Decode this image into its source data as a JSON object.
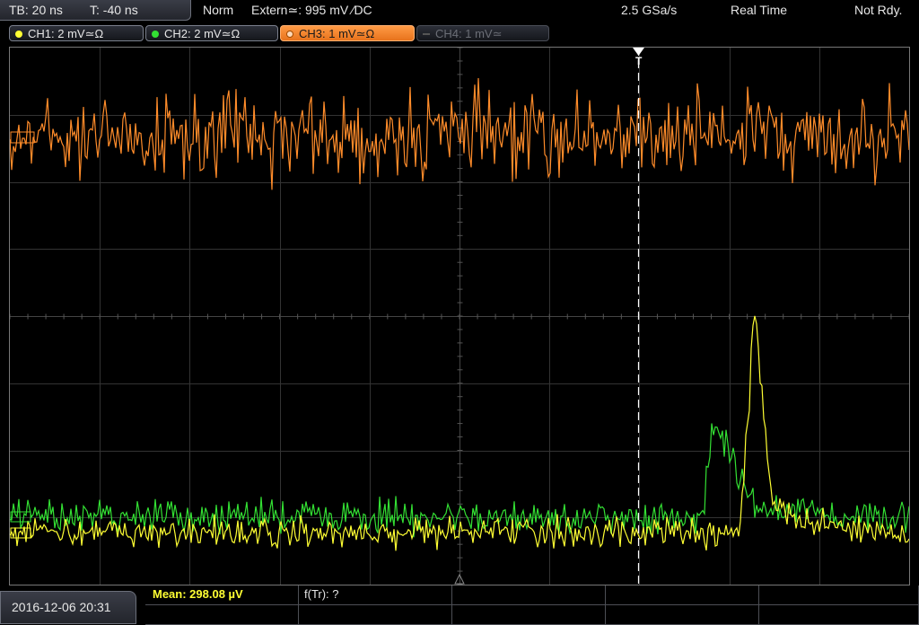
{
  "header": {
    "timebase": "TB: 20 ns",
    "trigger_time": "T: -40 ns",
    "mode": "Norm",
    "trigger_source": "Extern≃: 995 mV ∕DC",
    "sample_rate": "2.5 GSa/s",
    "acq_mode": "Real Time",
    "status": "Not Rdy."
  },
  "channels": [
    {
      "label": "CH1: 2 mV≃Ω",
      "color": "#ffff33",
      "state": "on"
    },
    {
      "label": "CH2: 2 mV≃Ω",
      "color": "#33e033",
      "state": "on"
    },
    {
      "label": "CH3: 1 mV≃Ω",
      "color": "#ff8c2a",
      "state": "active"
    },
    {
      "label": "CH4: 1 mV≃",
      "color": "#555",
      "state": "off"
    }
  ],
  "trigger_marker": "T",
  "colors": {
    "ch1": "#ffff33",
    "ch2": "#33e033",
    "ch3": "#ff8c2a",
    "grid": "#3a3a3a"
  },
  "footer": {
    "datetime": "2016-12-06 20:31",
    "measurement_1": "Mean: 298.08 µV",
    "measurement_2": "f(Tr): ?"
  }
}
